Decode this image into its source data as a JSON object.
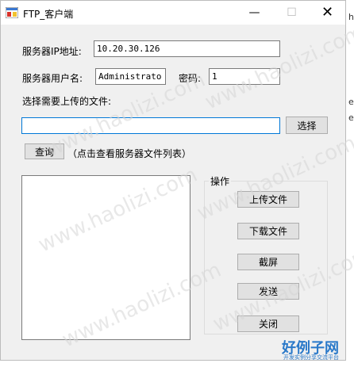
{
  "window": {
    "title": "FTP_客户端",
    "controls": {
      "minimize": "—",
      "maximize": "☐",
      "close": "✕"
    }
  },
  "form": {
    "server_ip_label": "服务器IP地址:",
    "server_ip_value": "10.20.30.126",
    "server_user_label": "服务器用户名:",
    "server_user_value": "Administrator",
    "password_label": "密码:",
    "password_value": "1",
    "upload_file_label": "选择需要上传的文件:",
    "upload_file_value": "",
    "select_button": "选择",
    "query_button": "查询",
    "query_hint": "（点击查看服务器文件列表）"
  },
  "operations": {
    "group_title": "操作",
    "upload_button": "上传文件",
    "download_button": "下载文件",
    "screenshot_button": "截屏",
    "send_button": "发送",
    "close_button": "关闭"
  },
  "file_list": {
    "items": []
  },
  "background_chars": [
    "hi",
    "e",
    "e"
  ],
  "watermarks": [
    "www.haolizi.com",
    "www.haolizi.com",
    "www.haolizi.com",
    "www.haolizi.com",
    "www.haolizi.com",
    "www.haolizi.com"
  ],
  "brand": {
    "name": "好例子网",
    "subtitle": "开发实例分享交流平台",
    "color": "#2a79c9"
  },
  "colors": {
    "window_bg": "#f0f0f0",
    "focus_border": "#0078d7",
    "button_bg": "#e1e1e1"
  }
}
